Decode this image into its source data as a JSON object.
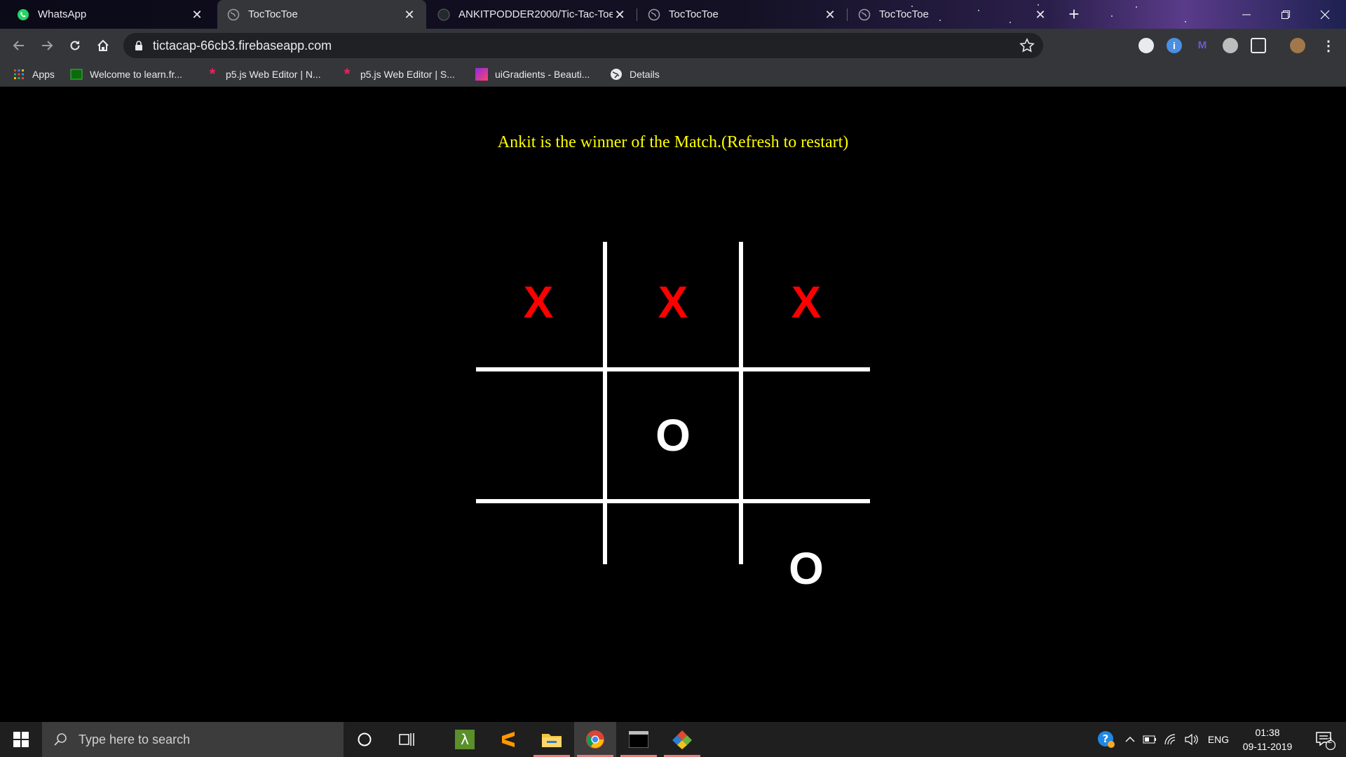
{
  "browser": {
    "tabs": [
      {
        "title": "WhatsApp",
        "icon": "whatsapp-icon",
        "active": false
      },
      {
        "title": "TocTocToe",
        "icon": "globe-icon",
        "active": true
      },
      {
        "title": "ANKITPODDER2000/Tic-Tac-Toe",
        "icon": "github-icon",
        "active": false
      },
      {
        "title": "TocTocToe",
        "icon": "globe-icon",
        "active": false
      },
      {
        "title": "TocTocToe",
        "icon": "globe-icon",
        "active": false
      }
    ],
    "url": "tictacap-66cb3.firebaseapp.com",
    "bookmarks": [
      {
        "label": "Apps",
        "icon": "apps-grid-icon"
      },
      {
        "label": "Welcome to learn.fr...",
        "icon": "learn-icon"
      },
      {
        "label": "p5.js Web Editor | N...",
        "icon": "p5js-icon"
      },
      {
        "label": "p5.js Web Editor | S...",
        "icon": "p5js-icon"
      },
      {
        "label": "uiGradients - Beauti...",
        "icon": "uigradients-icon"
      },
      {
        "label": "Details",
        "icon": "globe-icon"
      }
    ]
  },
  "game": {
    "status": "Ankit is the winner of the Match.(Refresh to restart)",
    "board": [
      [
        "X",
        "X",
        "X"
      ],
      [
        "",
        "O",
        ""
      ],
      [
        "",
        "",
        "O"
      ]
    ]
  },
  "taskbar": {
    "search_placeholder": "Type here to search",
    "language": "ENG",
    "time": "01:38",
    "date": "09-11-2019",
    "notification_count": "2"
  },
  "colors": {
    "status_text": "#ffff00",
    "x_mark": "#ff0000",
    "o_mark": "#ffffff",
    "grid": "#ffffff"
  }
}
